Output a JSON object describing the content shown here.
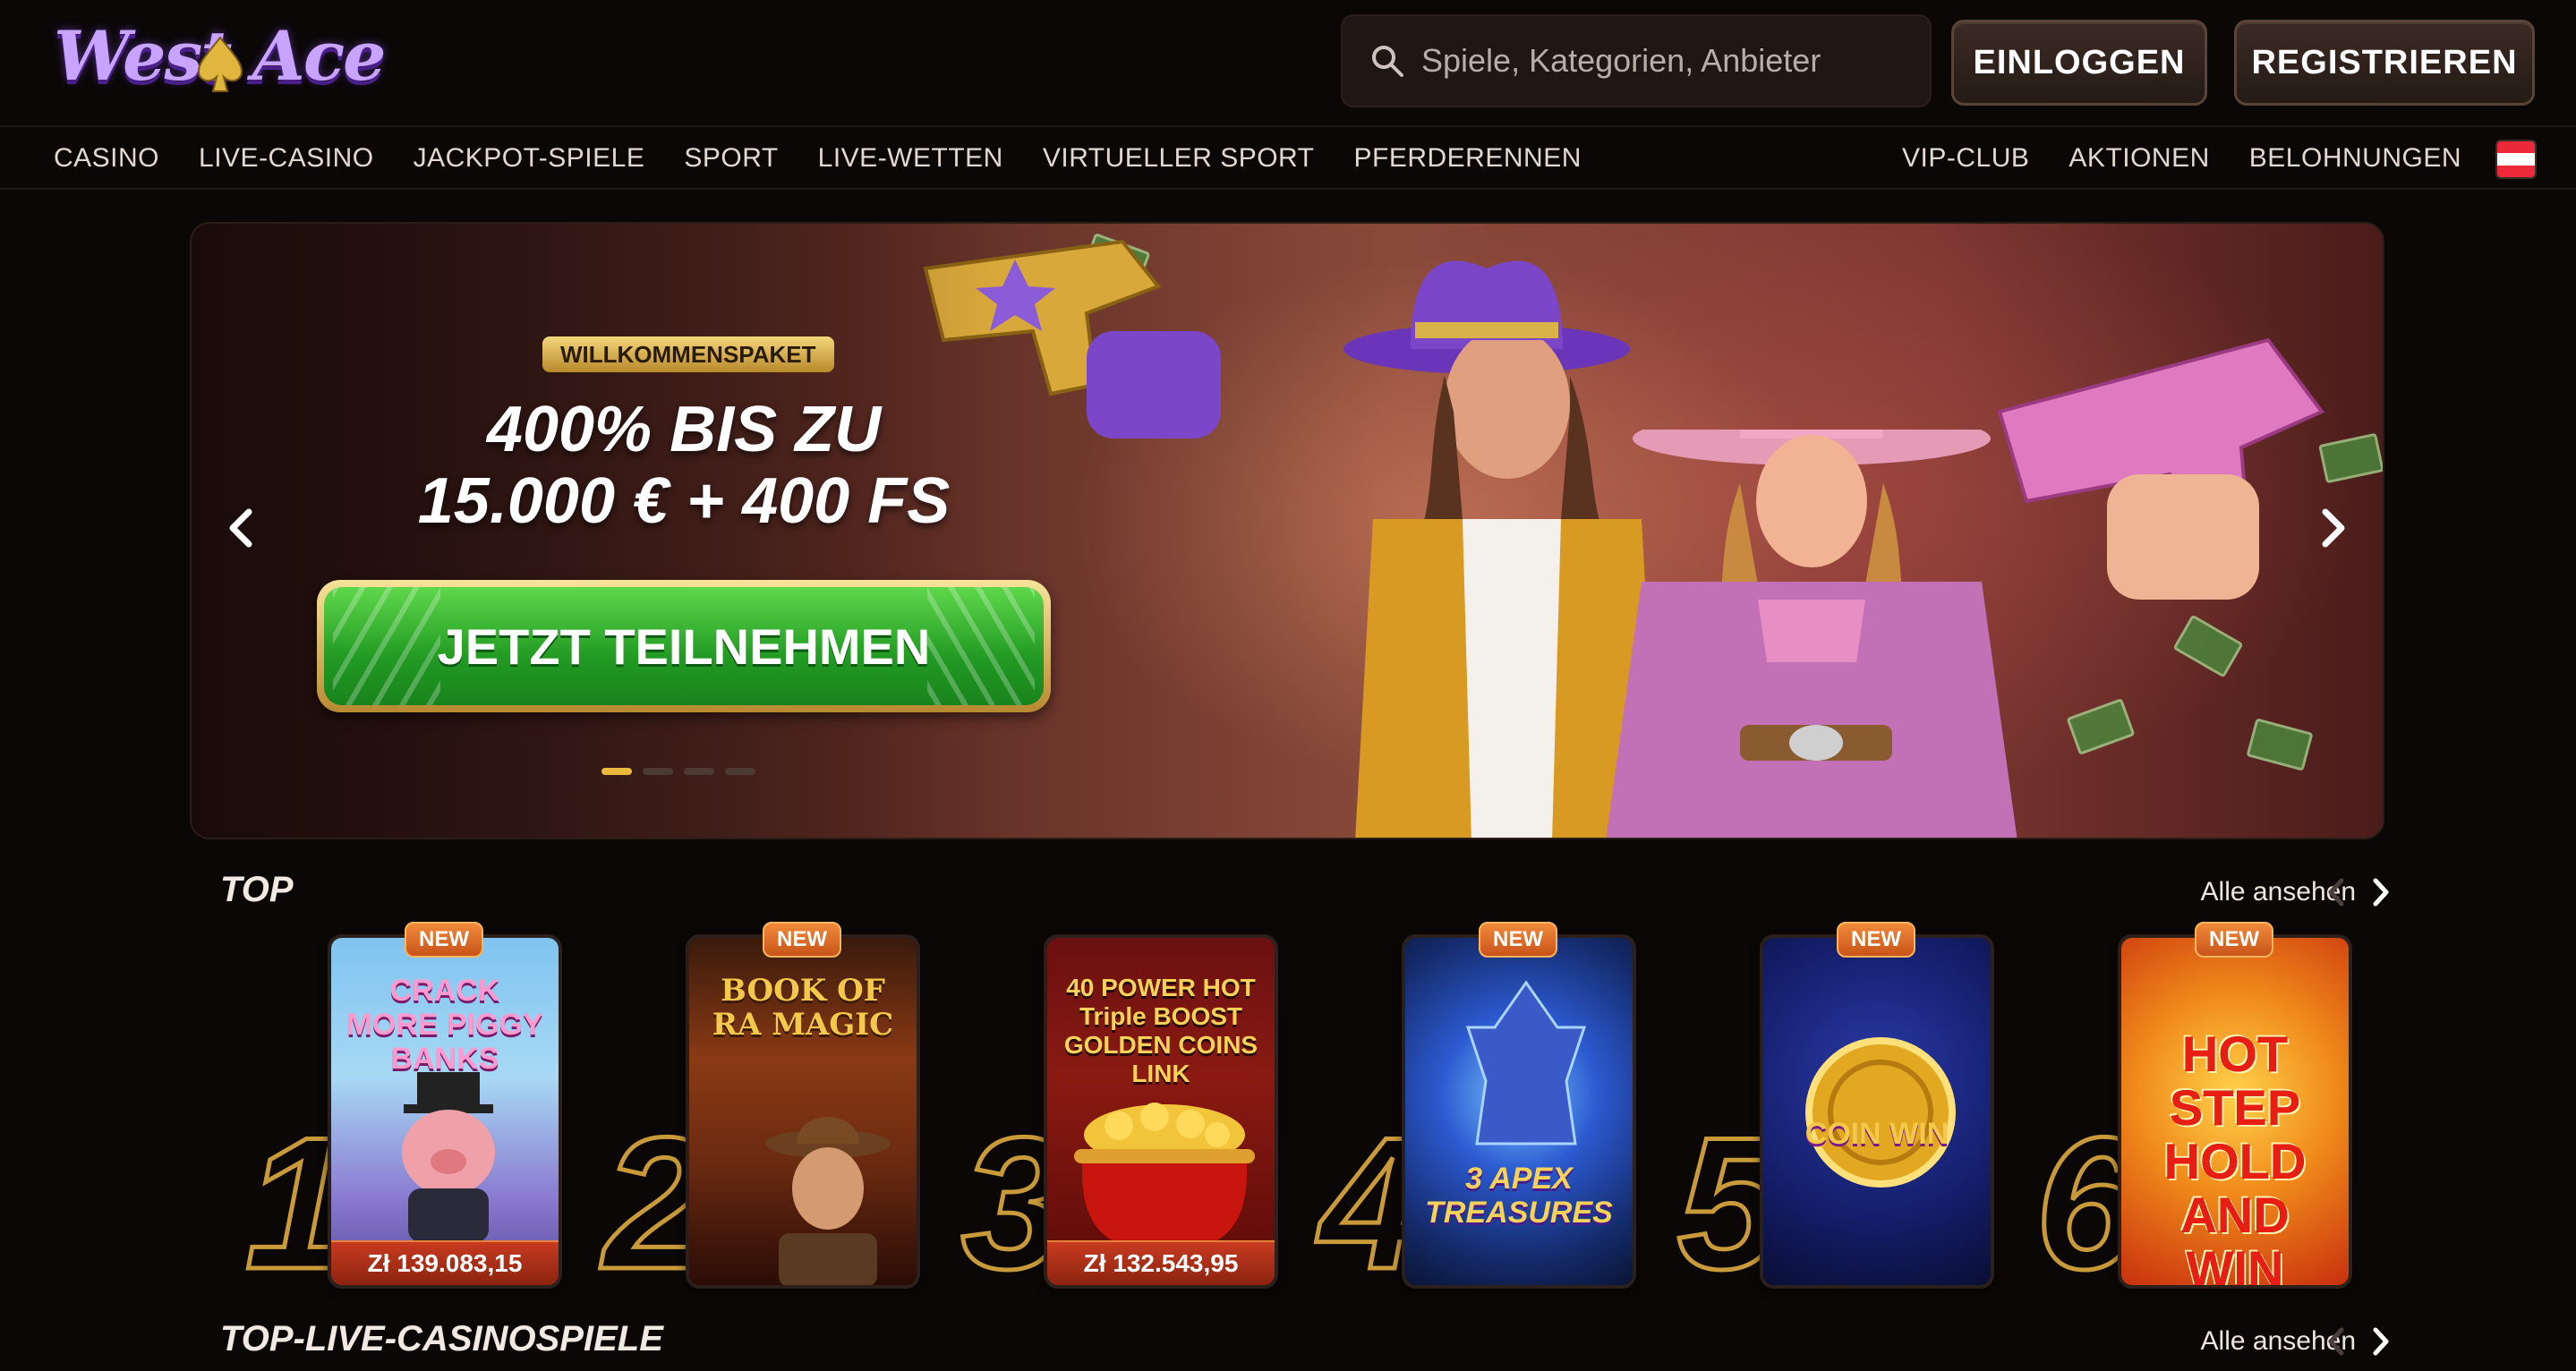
{
  "brand": {
    "logo_text": "West Ace"
  },
  "search": {
    "placeholder": "Spiele, Kategorien, Anbieter"
  },
  "auth": {
    "login_label": "EINLOGGEN",
    "register_label": "REGISTRIEREN"
  },
  "nav": {
    "left": [
      "CASINO",
      "LIVE-CASINO",
      "JACKPOT-SPIELE",
      "SPORT",
      "LIVE-WETTEN",
      "VIRTUELLER SPORT",
      "PFERDERENNEN"
    ],
    "right": [
      "VIP-CLUB",
      "AKTIONEN",
      "BELOHNUNGEN"
    ],
    "language_flag": "flag-austria-icon"
  },
  "banner": {
    "badge": "WILLKOMMENSPAKET",
    "title_line1": "400% BIS ZU",
    "title_line2": "15.000 € + 400 FS",
    "cta_label": "JETZT TEILNEHMEN",
    "slide_count": 4,
    "active_slide": 1
  },
  "top_section": {
    "title": "TOP",
    "view_all": "Alle ansehen",
    "games": [
      {
        "rank": "1",
        "badge": "NEW",
        "name": "CRACK MORE PIGGY BANKS",
        "jackpot": "Zł 139.083,15"
      },
      {
        "rank": "2",
        "badge": "NEW",
        "name": "BOOK OF RA MAGIC",
        "jackpot": ""
      },
      {
        "rank": "3",
        "badge": "",
        "name": "40 POWER HOT Triple BOOST GOLDEN COINS LINK",
        "jackpot": "Zł 132.543,95"
      },
      {
        "rank": "4",
        "badge": "NEW",
        "name": "3 APEX TREASURES",
        "jackpot": ""
      },
      {
        "rank": "5",
        "badge": "NEW",
        "name": "COIN WIN",
        "jackpot": ""
      },
      {
        "rank": "6",
        "badge": "NEW",
        "name": "HOT STEP HOLD AND WIN",
        "jackpot": ""
      }
    ]
  },
  "live_section": {
    "title": "TOP-LIVE-CASINOSPIELE",
    "view_all": "Alle ansehen"
  },
  "colors": {
    "accent_gold": "#e8b93a",
    "cta_green": "#229a23",
    "badge_orange": "#f08a3a",
    "logo_purple": "#c9a4ff"
  }
}
